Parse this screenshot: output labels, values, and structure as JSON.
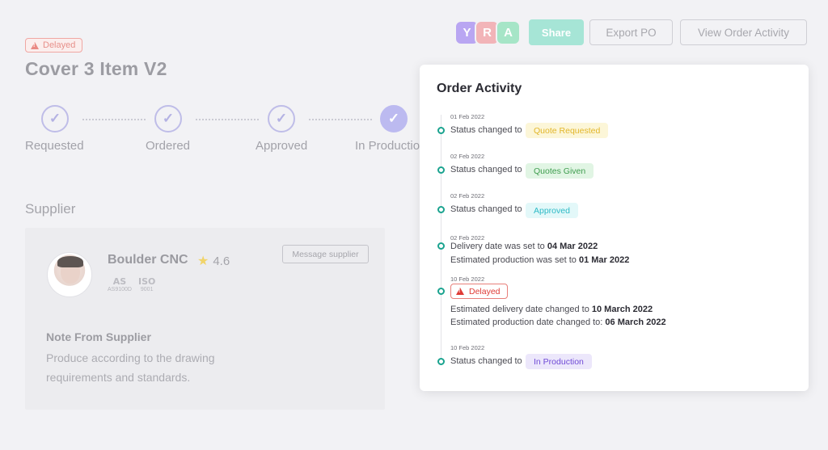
{
  "header": {
    "status_badge": "Delayed",
    "title": "Cover 3 Item V2"
  },
  "steps": [
    {
      "label": "Requested"
    },
    {
      "label": "Ordered"
    },
    {
      "label": "Approved"
    },
    {
      "label": "In Production"
    }
  ],
  "supplier": {
    "heading": "Supplier",
    "name": "Boulder CNC",
    "rating": "4.6",
    "certs": [
      {
        "mark": "AS",
        "label": "AS9100D"
      },
      {
        "mark": "ISO",
        "label": "9001"
      }
    ],
    "message_button": "Message supplier",
    "note_title": "Note From Supplier",
    "note_body": "Produce according to the drawing requirements and standards."
  },
  "toolbar": {
    "avatars": [
      {
        "initial": "Y",
        "color": "#b9a6f2"
      },
      {
        "initial": "R",
        "color": "#f2b4b8"
      },
      {
        "initial": "A",
        "color": "#a6e5c7"
      }
    ],
    "share_label": "Share",
    "export_label": "Export PO",
    "view_activity_label": "View Order Activity"
  },
  "panel": {
    "title": "Order Activity",
    "items": [
      {
        "date": "01 Feb 2022",
        "text": "Status changed to",
        "status": "Quote Requested"
      },
      {
        "date": "02 Feb 2022",
        "text": "Status changed to",
        "status": "Quotes Given"
      },
      {
        "date": "02 Feb 2022",
        "text": "Status changed to",
        "status": "Approved"
      },
      {
        "date": "02 Feb 2022",
        "line1_prefix": "Delivery date was set to ",
        "line1_value": "04 Mar 2022",
        "line2_prefix": "Estimated production was set to ",
        "line2_value": "01 Mar 2022"
      },
      {
        "date": "10 Feb 2022",
        "status": "Delayed",
        "line1_prefix": "Estimated delivery date changed to ",
        "line1_value": "10 March 2022",
        "line2_prefix": "Estimated production date changed to: ",
        "line2_value": "06 March 2022"
      },
      {
        "date": "10 Feb 2022",
        "text": "Status changed to",
        "status": "In Production"
      }
    ]
  },
  "colors": {
    "accent_teal": "#1aa38f",
    "delayed_red": "#df3b35",
    "step_purple": "#bcbaf0"
  }
}
